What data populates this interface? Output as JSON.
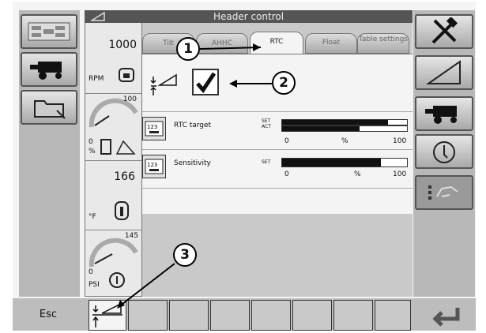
{
  "title": "Header control",
  "tabs": [
    {
      "label": "Tilt"
    },
    {
      "label": "AHHC"
    },
    {
      "label": "RTC"
    },
    {
      "label": "Float"
    },
    {
      "label": "Table settings"
    }
  ],
  "gauges": {
    "rpm_value": "1000",
    "rpm_unit": "RPM",
    "fuel_max": "100",
    "fuel_min": "0",
    "fuel_unit": "%",
    "temp_value": "166",
    "temp_unit": "°F",
    "pressure_max": "145",
    "pressure_min": "0",
    "pressure_unit": "PSI"
  },
  "rows": [
    {
      "label": "RTC target",
      "set": "SET",
      "act": "ACT",
      "min": "0",
      "unit": "%",
      "max": "100",
      "set_fraction": 0.85,
      "act_fraction": 0.62
    },
    {
      "label": "Sensitivity",
      "set": "SET",
      "min": "0",
      "unit": "%",
      "max": "100",
      "set_fraction": 0.79
    }
  ],
  "bottom": {
    "esc": "Esc"
  },
  "callouts": [
    "1",
    "2",
    "3"
  ]
}
